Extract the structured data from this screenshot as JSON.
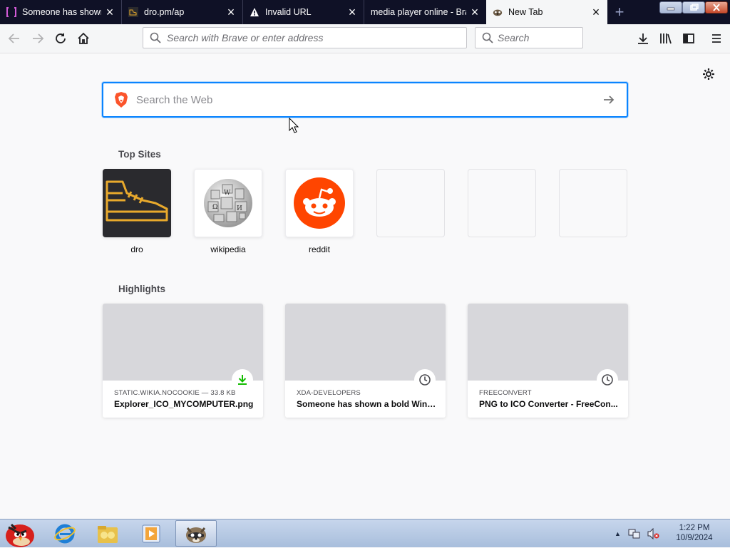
{
  "tabs": [
    {
      "label": "Someone has shown",
      "icon": "xda-icon"
    },
    {
      "label": "dro.pm/ap",
      "icon": "shoe-icon"
    },
    {
      "label": "Invalid URL",
      "icon": "warning-icon"
    },
    {
      "label": "media player online - Bra",
      "icon": "none"
    },
    {
      "label": "New Tab",
      "icon": "brave-icon",
      "active": true
    }
  ],
  "toolbar": {
    "address_placeholder": "Search with Brave or enter address",
    "search_placeholder": "Search"
  },
  "newtab": {
    "search_placeholder": "Search the Web",
    "top_sites_title": "Top Sites",
    "top_sites": [
      {
        "label": "dro"
      },
      {
        "label": "wikipedia"
      },
      {
        "label": "reddit"
      },
      {
        "label": ""
      },
      {
        "label": ""
      },
      {
        "label": ""
      }
    ],
    "highlights_title": "Highlights",
    "highlights": [
      {
        "host": "STATIC.WIKIA.NOCOOKIE — 33.8 KB",
        "title": "Explorer_ICO_MYCOMPUTER.png",
        "badge": "download-icon"
      },
      {
        "host": "XDA-DEVELOPERS",
        "title": "Someone has shown a bold Wind...",
        "badge": "clock-icon"
      },
      {
        "host": "FREECONVERT",
        "title": "PNG to ICO Converter - FreeCon...",
        "badge": "clock-icon"
      }
    ]
  },
  "taskbar": {
    "time": "1:22 PM",
    "date": "10/9/2024"
  },
  "colors": {
    "accent": "#0a84ff",
    "tabbar": "#0f1126",
    "reddit": "#ff4500",
    "brave": "#fb542b",
    "download": "#12bc00"
  }
}
